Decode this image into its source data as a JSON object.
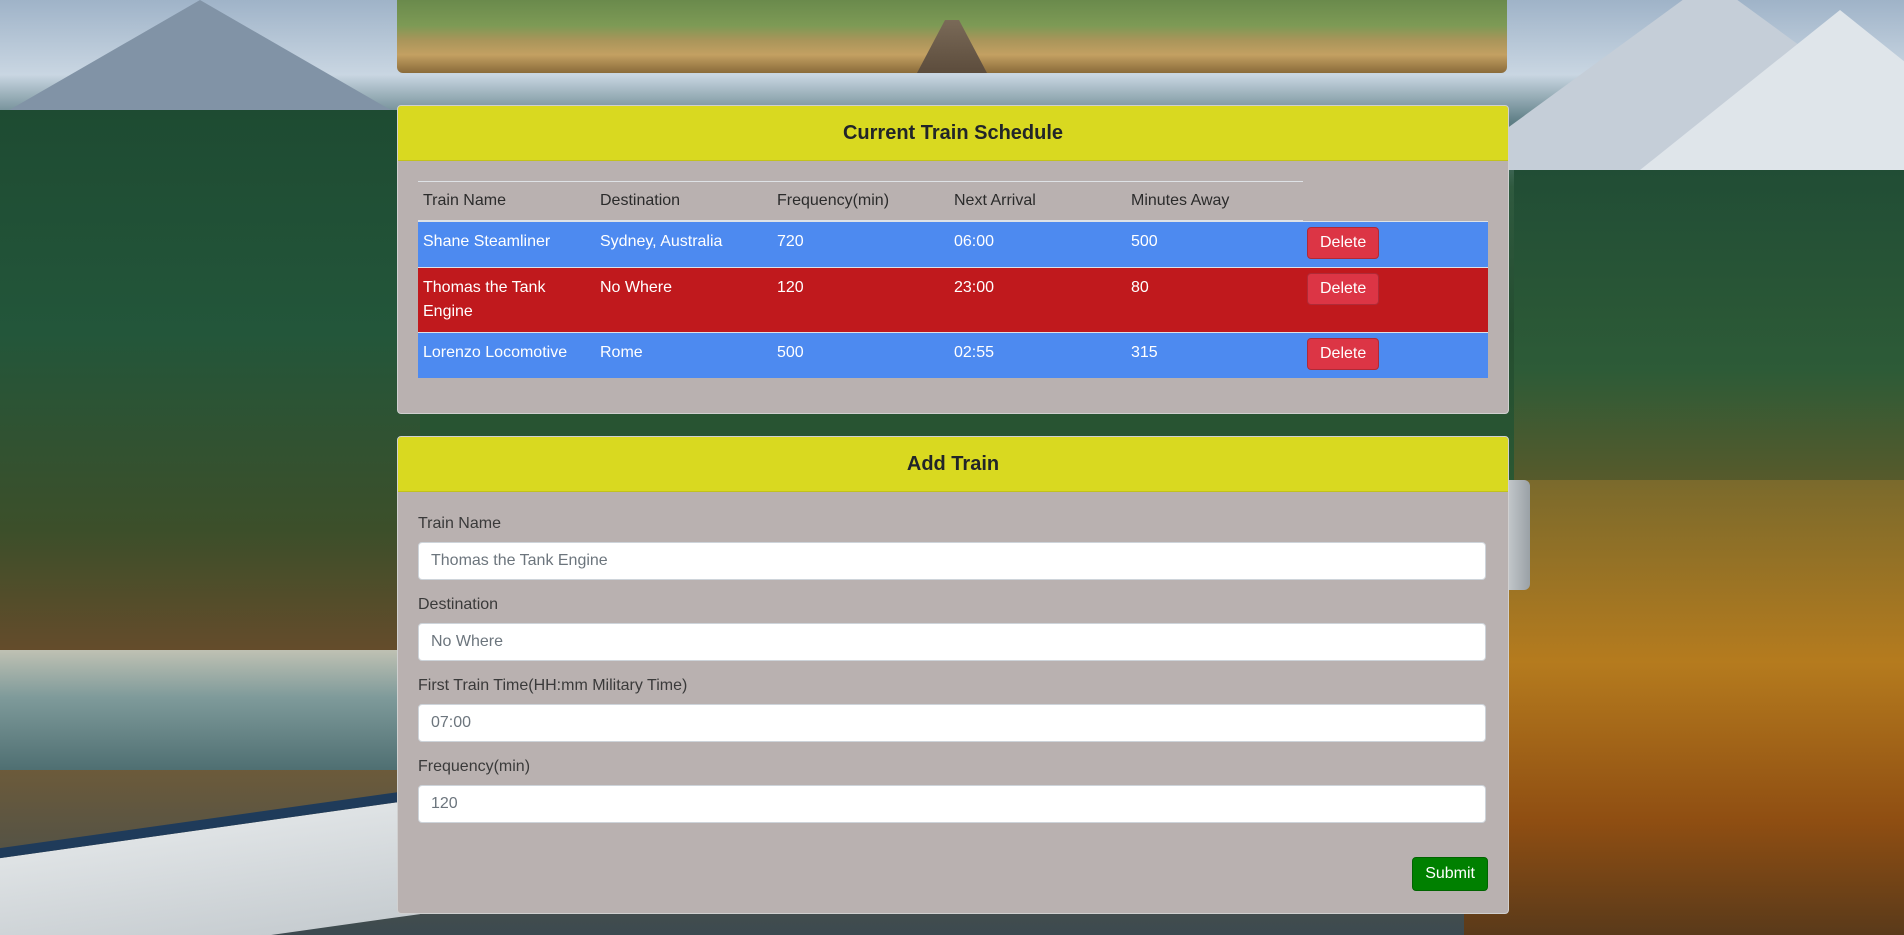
{
  "schedule": {
    "title": "Current Train Schedule",
    "columns": [
      "Train Name",
      "Destination",
      "Frequency(min)",
      "Next Arrival",
      "Minutes Away"
    ],
    "rows": [
      {
        "name": "Shane Steamliner",
        "destination": "Sydney, Australia",
        "frequency": "720",
        "next_arrival": "06:00",
        "minutes_away": "500",
        "color": "#4d8af0"
      },
      {
        "name": "Thomas the Tank Engine",
        "destination": "No Where",
        "frequency": "120",
        "next_arrival": "23:00",
        "minutes_away": "80",
        "color": "#c0191d"
      },
      {
        "name": "Lorenzo Locomotive",
        "destination": "Rome",
        "frequency": "500",
        "next_arrival": "02:55",
        "minutes_away": "315",
        "color": "#4d8af0"
      }
    ],
    "delete_label": "Delete"
  },
  "add_train": {
    "title": "Add Train",
    "fields": {
      "train_name": {
        "label": "Train Name",
        "placeholder": "Thomas the Tank Engine"
      },
      "destination": {
        "label": "Destination",
        "placeholder": "No Where"
      },
      "first_time": {
        "label": "First Train Time(HH:mm Military Time)",
        "placeholder": "07:00"
      },
      "frequency": {
        "label": "Frequency(min)",
        "placeholder": "120"
      }
    },
    "submit_label": "Submit"
  },
  "colors": {
    "header": "#d9d920",
    "card": "#b9b1b0",
    "row_blue": "#4d8af0",
    "row_red": "#c0191d",
    "delete": "#dc3545",
    "submit": "#008000"
  }
}
